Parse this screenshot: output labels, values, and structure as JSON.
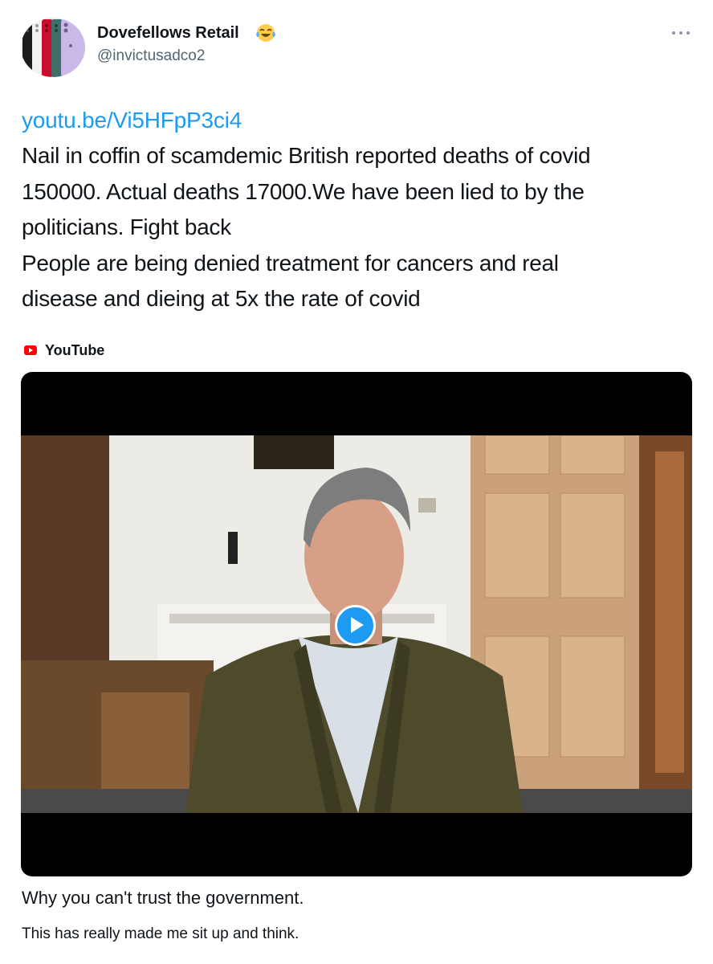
{
  "author": {
    "display_name": "Dovefellows Retail",
    "emoji": "😂",
    "handle": "@invictusadco2"
  },
  "more_icon": "more-horizontal-icon",
  "tweet": {
    "link": "youtu.be/Vi5HFpP3ci4",
    "lines": [
      "Nail in coffin of scamdemic British reported deaths of covid",
      "150000. Actual deaths 17000.We have been lied to by the",
      "politicians. Fight back",
      "People are being denied treatment for cancers and real",
      "disease and dieing at 5x the rate of covid"
    ]
  },
  "card": {
    "source_icon": "youtube-icon",
    "source": "YouTube",
    "play_icon": "play-icon",
    "title": "Why you can't trust the government.",
    "description": "This has really made me sit up and think."
  },
  "colors": {
    "link": "#1d9bf0",
    "play_button": "#1d9bf0",
    "youtube_red": "#ff0000",
    "secondary_text": "#536471"
  }
}
